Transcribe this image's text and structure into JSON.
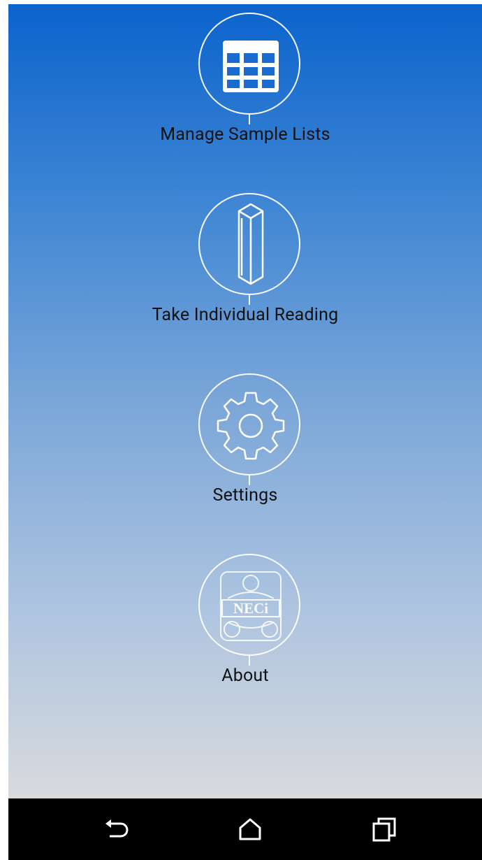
{
  "menu": {
    "items": [
      {
        "key": "manage",
        "label": "Manage Sample Lists",
        "icon": "table-grid-icon"
      },
      {
        "key": "reading",
        "label": "Take Individual Reading",
        "icon": "cuvette-icon"
      },
      {
        "key": "settings",
        "label": "Settings",
        "icon": "gear-icon"
      },
      {
        "key": "about",
        "label": "About",
        "icon": "neci-logo-icon",
        "logo_text": "NECi"
      }
    ]
  },
  "navbar": {
    "back": "back-icon",
    "home": "home-icon",
    "recents": "recents-icon"
  },
  "colors": {
    "gradient_top": "#0b63cc",
    "gradient_bottom": "#d8dadd",
    "navbar": "#000000",
    "label_text": "#111111"
  }
}
